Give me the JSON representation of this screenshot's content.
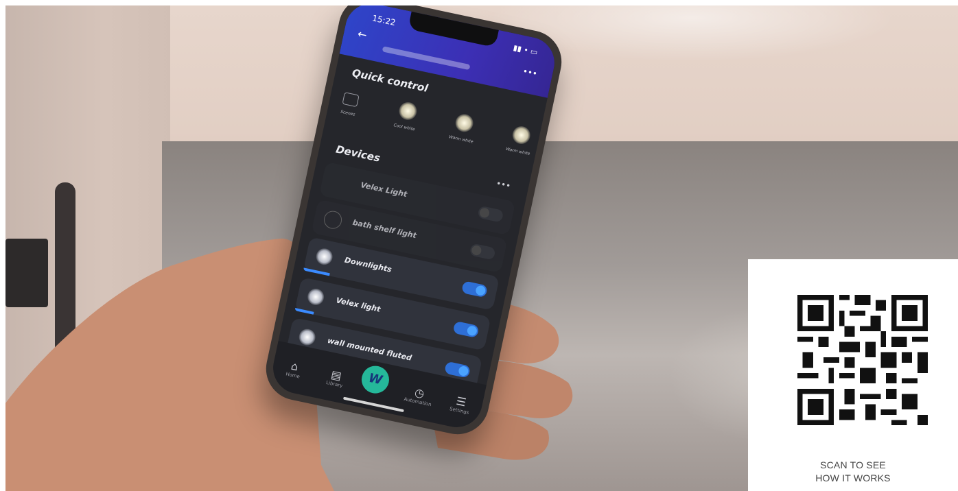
{
  "phone": {
    "status_time": "15:22",
    "status_icons": "▮▮ • ▭",
    "back_icon": "←",
    "more_icon": "•••",
    "quick_control": {
      "title": "Quick control",
      "items": [
        {
          "label": "Scenes"
        },
        {
          "label": "Cool white"
        },
        {
          "label": "Warm white"
        },
        {
          "label": "Warm white"
        }
      ]
    },
    "devices": {
      "title": "Devices",
      "more_icon": "•••",
      "items": [
        {
          "name": "Velex Light",
          "on": false
        },
        {
          "name": "bath shelf light",
          "on": false
        },
        {
          "name": "Downlights",
          "on": true
        },
        {
          "name": "Velex light",
          "on": true
        },
        {
          "name": "wall mounted fluted",
          "on": true
        }
      ]
    },
    "tabs": [
      {
        "label": "Home",
        "icon": "home-icon",
        "glyph": "⌂"
      },
      {
        "label": "Library",
        "icon": "library-icon",
        "glyph": "▤"
      },
      {
        "label": "W",
        "icon": "wiz-logo",
        "glyph": "W"
      },
      {
        "label": "Automation",
        "icon": "clock-icon",
        "glyph": "◷"
      },
      {
        "label": "Settings",
        "icon": "settings-icon",
        "glyph": "☰"
      }
    ]
  },
  "qr": {
    "caption_line1": "SCAN TO SEE",
    "caption_line2": "HOW IT WORKS"
  }
}
